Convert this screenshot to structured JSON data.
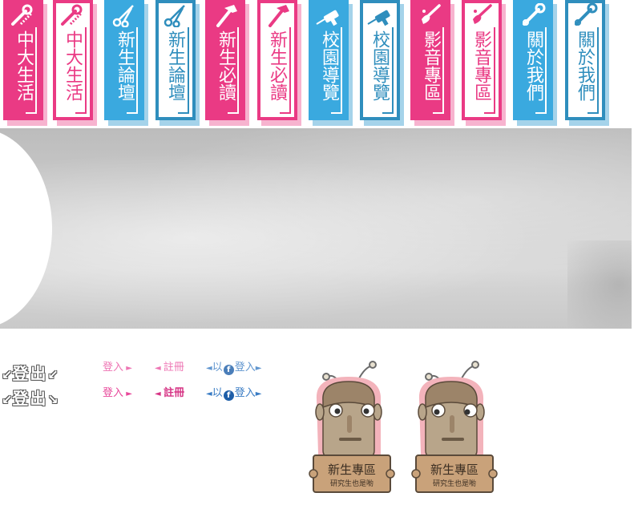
{
  "nav": {
    "tabs": [
      {
        "label": "中大生活",
        "icon": "wrench-screw-icon",
        "style": "filled",
        "color": "pink"
      },
      {
        "label": "中大生活",
        "icon": "wrench-screw-icon",
        "style": "outline",
        "color": "pink"
      },
      {
        "label": "新生論壇",
        "icon": "scissors-icon",
        "style": "filled",
        "color": "blue"
      },
      {
        "label": "新生論壇",
        "icon": "scissors-icon",
        "style": "outline",
        "color": "blue"
      },
      {
        "label": "新生必讀",
        "icon": "hammer-icon",
        "style": "filled",
        "color": "pink"
      },
      {
        "label": "新生必讀",
        "icon": "hammer-icon",
        "style": "outline",
        "color": "pink"
      },
      {
        "label": "校園導覽",
        "icon": "drill-icon",
        "style": "filled",
        "color": "blue"
      },
      {
        "label": "校園導覽",
        "icon": "drill-icon",
        "style": "outline",
        "color": "blue"
      },
      {
        "label": "影音專區",
        "icon": "paintbrush-icon",
        "style": "filled",
        "color": "pink"
      },
      {
        "label": "影音專區",
        "icon": "paintbrush-icon",
        "style": "outline",
        "color": "pink"
      },
      {
        "label": "關於我們",
        "icon": "spanner-icon",
        "style": "filled",
        "color": "blue"
      },
      {
        "label": "關於我們",
        "icon": "spanner-icon",
        "style": "outline",
        "color": "blue"
      }
    ]
  },
  "auth": {
    "logout_1": "登出",
    "logout_2": "登出",
    "login": "登入",
    "register": "註冊",
    "fb_prefix": "以",
    "fb_login": "登入",
    "fb_icon": "facebook-icon"
  },
  "mascot": {
    "sign_title": "新生專區",
    "sign_subtitle": "研究生也是喲"
  },
  "colors": {
    "pink": "#ea3a84",
    "pink_shadow": "#f7b3cf",
    "blue": "#3aa9df",
    "blue_dark": "#2f8ebd",
    "blue_shadow": "#a5d3ea"
  }
}
